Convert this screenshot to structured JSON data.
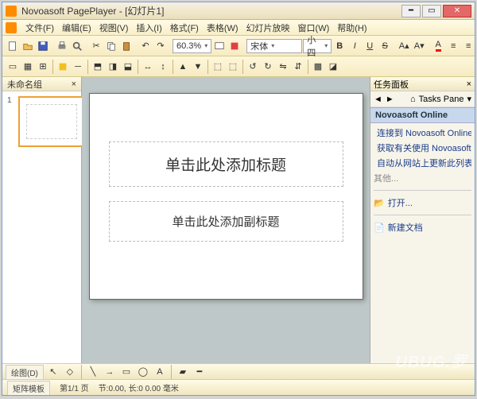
{
  "window": {
    "title": "Novoasoft PagePlayer - [幻灯片1]"
  },
  "menu": {
    "items": [
      "文件(F)",
      "编辑(E)",
      "视图(V)",
      "插入(I)",
      "格式(F)",
      "表格(W)",
      "幻灯片放映",
      "窗口(W)",
      "帮助(H)"
    ]
  },
  "toolbar1": {
    "zoom": "60.3%",
    "font_family": "宋体",
    "font_size": "小四",
    "btns": {
      "bold": "B",
      "italic": "I",
      "underline": "U",
      "strike": "S"
    }
  },
  "thumb_panel": {
    "header": "未命名组",
    "slide_number": "1"
  },
  "slide": {
    "title_placeholder": "单击此处添加标题",
    "subtitle_placeholder": "单击此处添加副标题"
  },
  "taskpane": {
    "header": "任务面板",
    "nav_label": "Tasks Pane",
    "section": "Novoasoft Online",
    "items": [
      {
        "label": "连接到 Novoasoft Online",
        "color": "#3cb04a"
      },
      {
        "label": "获取有关使用 Novoasoft PageP...",
        "color": "#f0c020"
      },
      {
        "label": "自动从网站上更新此列表",
        "color": "#f0c020"
      }
    ],
    "muted": "其他...",
    "open": "打开...",
    "newdoc": "新建文档"
  },
  "bottombar": {
    "tab1": "绘图(D)"
  },
  "statusbar": {
    "tab": "矩阵模板",
    "page": "第1/1 页",
    "pos": "节:0.00, 长:0  0.00 毫米"
  },
  "watermark": "UBUG.罗"
}
